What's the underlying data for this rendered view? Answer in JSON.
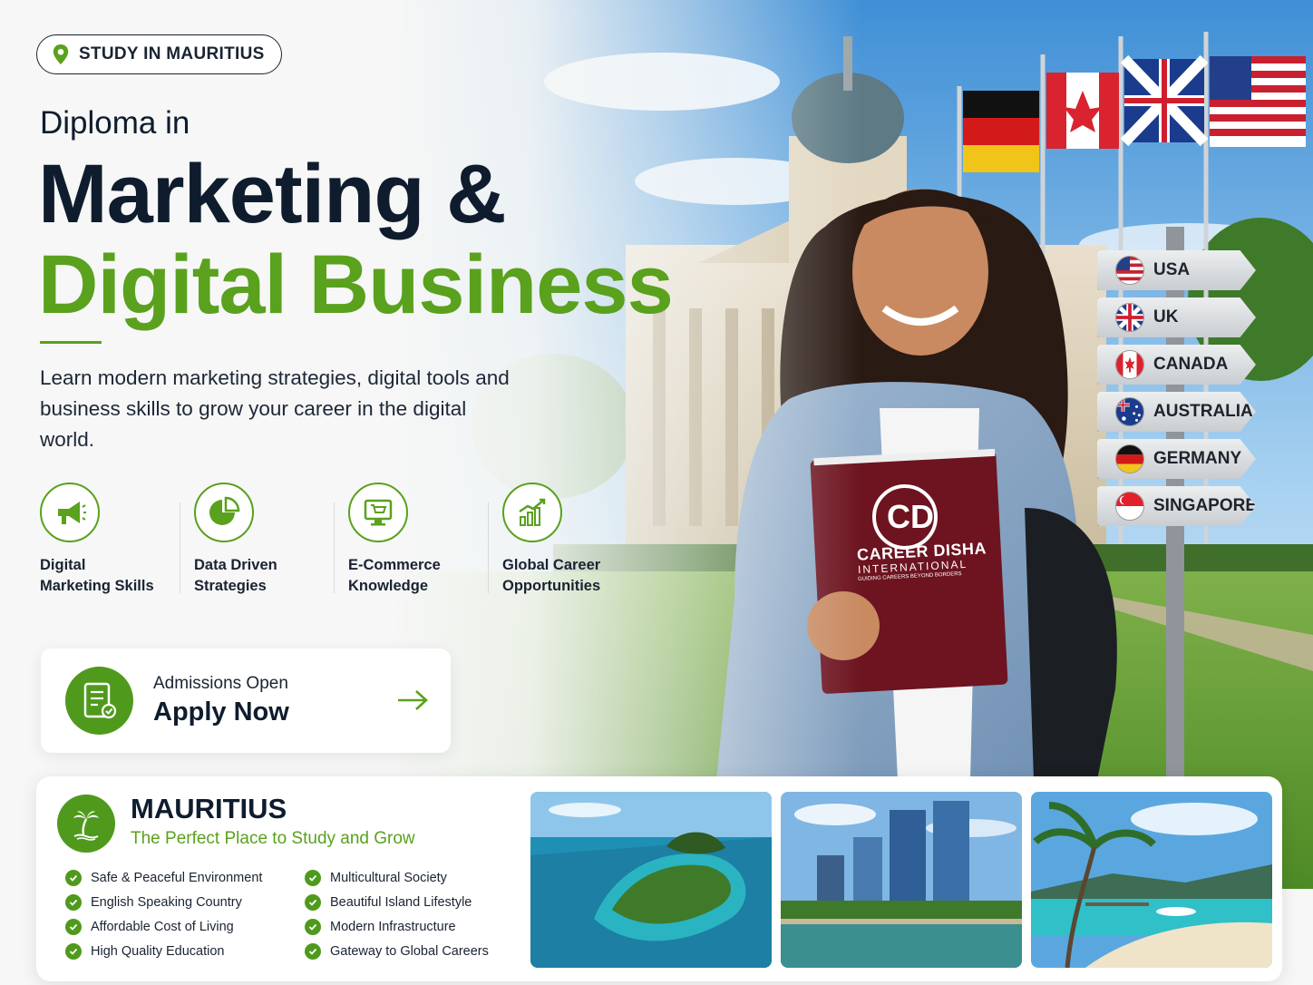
{
  "location": {
    "label": "STUDY IN MAURITIUS",
    "icon": "map-pin-icon"
  },
  "hero": {
    "subtitle": "Diploma in",
    "title_line1": "Marketing &",
    "title_line2": "Digital Business",
    "description": "Learn modern marketing strategies, digital tools and business skills to grow your career in the digital world."
  },
  "features": [
    {
      "line1": "Digital",
      "line2": "Marketing Skills",
      "icon": "megaphone-icon"
    },
    {
      "line1": "Data Driven",
      "line2": "Strategies",
      "icon": "pie-chart-icon"
    },
    {
      "line1": "E-Commerce",
      "line2": "Knowledge",
      "icon": "shopping-cart-icon"
    },
    {
      "line1": "Global Career",
      "line2": "Opportunities",
      "icon": "growth-chart-icon"
    }
  ],
  "apply": {
    "small": "Admissions Open",
    "big": "Apply Now"
  },
  "book": {
    "brand": "CAREER DISHA",
    "sub": "INTERNATIONAL",
    "tagline": "GUIDING CAREERS BEYOND BORDERS"
  },
  "countries": [
    "USA",
    "UK",
    "CANADA",
    "AUSTRALIA",
    "GERMANY",
    "SINGAPORE"
  ],
  "mauritius": {
    "title": "MAURITIUS",
    "tagline": "The Perfect Place to Study and Grow",
    "col1": [
      "Safe & Peaceful Environment",
      "English Speaking Country",
      "Affordable Cost of Living",
      "High Quality Education"
    ],
    "col2": [
      "Multicultural Society",
      "Beautiful Island Lifestyle",
      "Modern Infrastructure",
      "Gateway to Global Careers"
    ]
  },
  "colors": {
    "brand_green": "#5aa11d",
    "dark_navy": "#0f1c2e"
  }
}
